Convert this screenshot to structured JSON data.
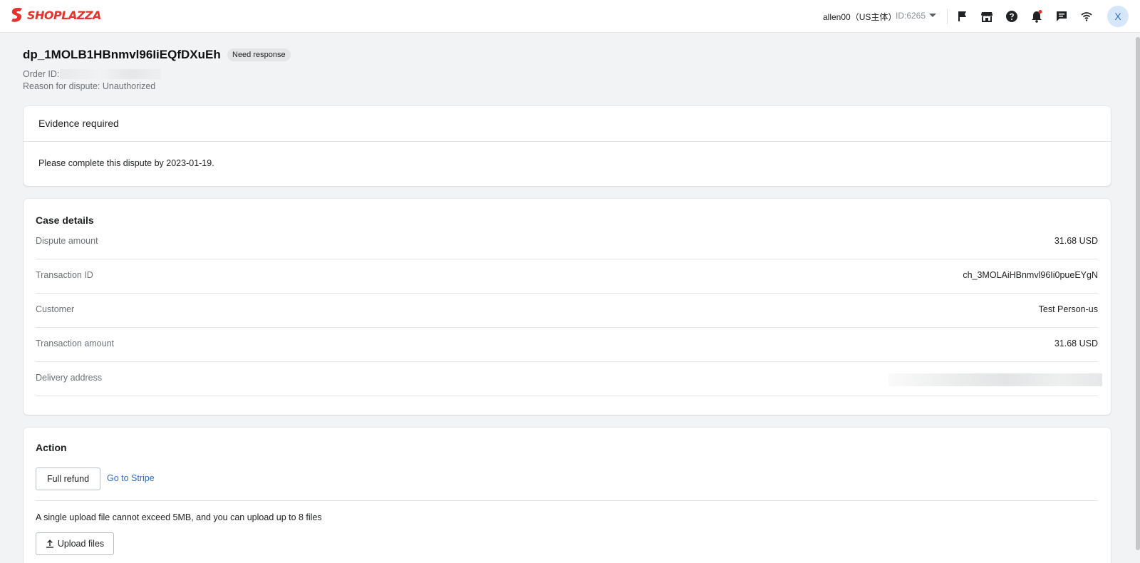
{
  "header": {
    "logo_text": "SHOPLAZZA",
    "account_name": "allen00（US主体）",
    "store_id": "ID:6265",
    "icons": [
      "flag-icon",
      "store-icon",
      "help-icon",
      "bell-icon",
      "chat-icon",
      "wifi-icon"
    ],
    "avatar_initial": "X",
    "brand_color": "#e5322d"
  },
  "dispute": {
    "id": "dp_1MOLB1HBnmvl96IiEQfDXuEh",
    "status": "Need response",
    "order_id_label": "Order ID:",
    "reason": "Reason for dispute: Unauthorized"
  },
  "evidence": {
    "title": "Evidence required",
    "message": "Please complete this dispute by 2023-01-19."
  },
  "case_details": {
    "title": "Case details",
    "rows": [
      {
        "label": "Dispute amount",
        "value": "31.68 USD"
      },
      {
        "label": "Transaction ID",
        "value": "ch_3MOLAiHBnmvl96Ii0pueEYgN"
      },
      {
        "label": "Customer",
        "value": "Test Person-us"
      },
      {
        "label": "Transaction amount",
        "value": "31.68 USD"
      },
      {
        "label": "Delivery address",
        "value": ""
      }
    ]
  },
  "action": {
    "title": "Action",
    "full_refund_label": "Full refund",
    "stripe_link_label": "Go to Stripe",
    "upload_note": "A single upload file cannot exceed 5MB, and you can upload up to 8 files",
    "upload_label": "Upload files",
    "link_color": "#2c6ecb"
  }
}
